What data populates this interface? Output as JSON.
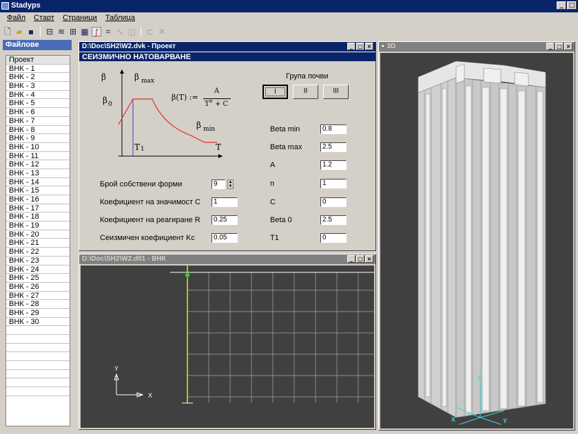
{
  "app": {
    "title": "Stadyps"
  },
  "menu": [
    "Файл",
    "Старт",
    "Страници",
    "Таблица"
  ],
  "toolbar": {
    "icons": [
      "new-file-icon",
      "open-folder-icon",
      "save-icon",
      "columns-icon",
      "layers-icon",
      "mesh-icon",
      "table-icon",
      "graph-icon",
      "chart-icon",
      "curve-icon",
      "box-icon",
      "copy-icon",
      "delete-icon"
    ]
  },
  "files": {
    "title": "Файлове",
    "items": [
      "Проект",
      "ВНК - 1",
      "ВНК - 2",
      "ВНК - 3",
      "ВНК - 4",
      "ВНК - 5",
      "ВНК - 6",
      "ВНК - 7",
      "ВНК - 8",
      "ВНК - 9",
      "ВНК - 10",
      "ВНК - 11",
      "ВНК - 12",
      "ВНК - 13",
      "ВНК - 14",
      "ВНК - 15",
      "ВНК - 16",
      "ВНК - 17",
      "ВНК - 18",
      "ВНК - 19",
      "ВНК - 20",
      "ВНК - 21",
      "ВНК - 22",
      "ВНК - 23",
      "ВНК - 24",
      "ВНК - 25",
      "ВНК - 26",
      "ВНК - 27",
      "ВНК - 28",
      "ВНК - 29",
      "ВНК - 30"
    ]
  },
  "project_window": {
    "title": "D:\\Doc\\SH2\\W2.dvk - Проект",
    "section": "СЕИЗМИЧНО НАТОВАРВАНЕ",
    "soil_group_label": "Група почви",
    "soil_groups": [
      "I",
      "II",
      "III"
    ],
    "diagram": {
      "beta": "β",
      "beta_max": "β",
      "max": "max",
      "beta0": "β",
      "zero": "0",
      "beta_min": "β",
      "min": "min",
      "t1": "T",
      "one": "1",
      "t": "T",
      "formula_lhs": "β(T) :=",
      "formula_num": "A",
      "formula_den": "T",
      "formula_exp": "n",
      "formula_den2": "+ C"
    },
    "left_params": [
      {
        "label": "Брой собствени форми",
        "value": "9"
      },
      {
        "label": "Коефициент на значимост C",
        "value": "1"
      },
      {
        "label": "Коефициент на реагиране R",
        "value": "0.25"
      },
      {
        "label": "Сеизмичен коефициент Kc",
        "value": "0.05"
      }
    ],
    "right_params": [
      {
        "label": "Beta min",
        "value": "0.8"
      },
      {
        "label": "Beta max",
        "value": "2.5"
      },
      {
        "label": "A",
        "value": "1.2"
      },
      {
        "label": "n",
        "value": "1"
      },
      {
        "label": "C",
        "value": "0"
      },
      {
        "label": "Beta 0",
        "value": "2.5"
      },
      {
        "label": "T1",
        "value": "0"
      }
    ]
  },
  "d01_window": {
    "title": "D:\\Doc\\SH2\\W2.d01 - ВНК",
    "axis_x": "X",
    "axis_y": "Y"
  },
  "w3d_window": {
    "title": "3D",
    "axis_x": "X",
    "axis_y": "Y",
    "axis_z": "Z"
  },
  "window_buttons": {
    "min": "_",
    "max": "□",
    "close": "×"
  },
  "colors": {
    "titlebar": "#0a246a",
    "curve": "#e03030",
    "t1_line": "#3040c0",
    "model_line": "#e8e800",
    "node": "#30d030"
  }
}
